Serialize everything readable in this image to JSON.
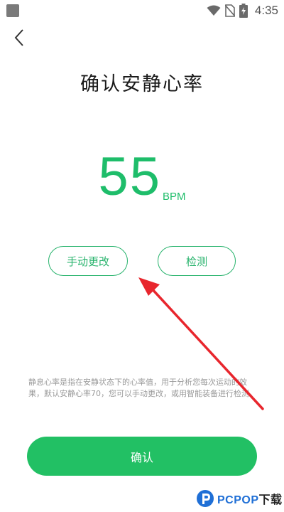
{
  "status_bar": {
    "time": "4:35",
    "icons": [
      "wifi-icon",
      "no-sim-icon",
      "battery-charging-icon"
    ]
  },
  "header": {
    "back_icon": "chevron-left-icon",
    "title": "确认安静心率"
  },
  "heart_rate": {
    "value": "55",
    "unit": "BPM"
  },
  "actions": {
    "manual_label": "手动更改",
    "detect_label": "检测"
  },
  "description": "静息心率是指在安静状态下的心率值，用于分析您每次运动的效果，默认安静心率70，您可以手动更改，或用智能装备进行检测。",
  "confirm_label": "确认",
  "watermark": {
    "brand": "PCPOP",
    "suffix": "下载"
  },
  "colors": {
    "accent": "#22c064",
    "annotation_arrow": "#e8262d"
  }
}
